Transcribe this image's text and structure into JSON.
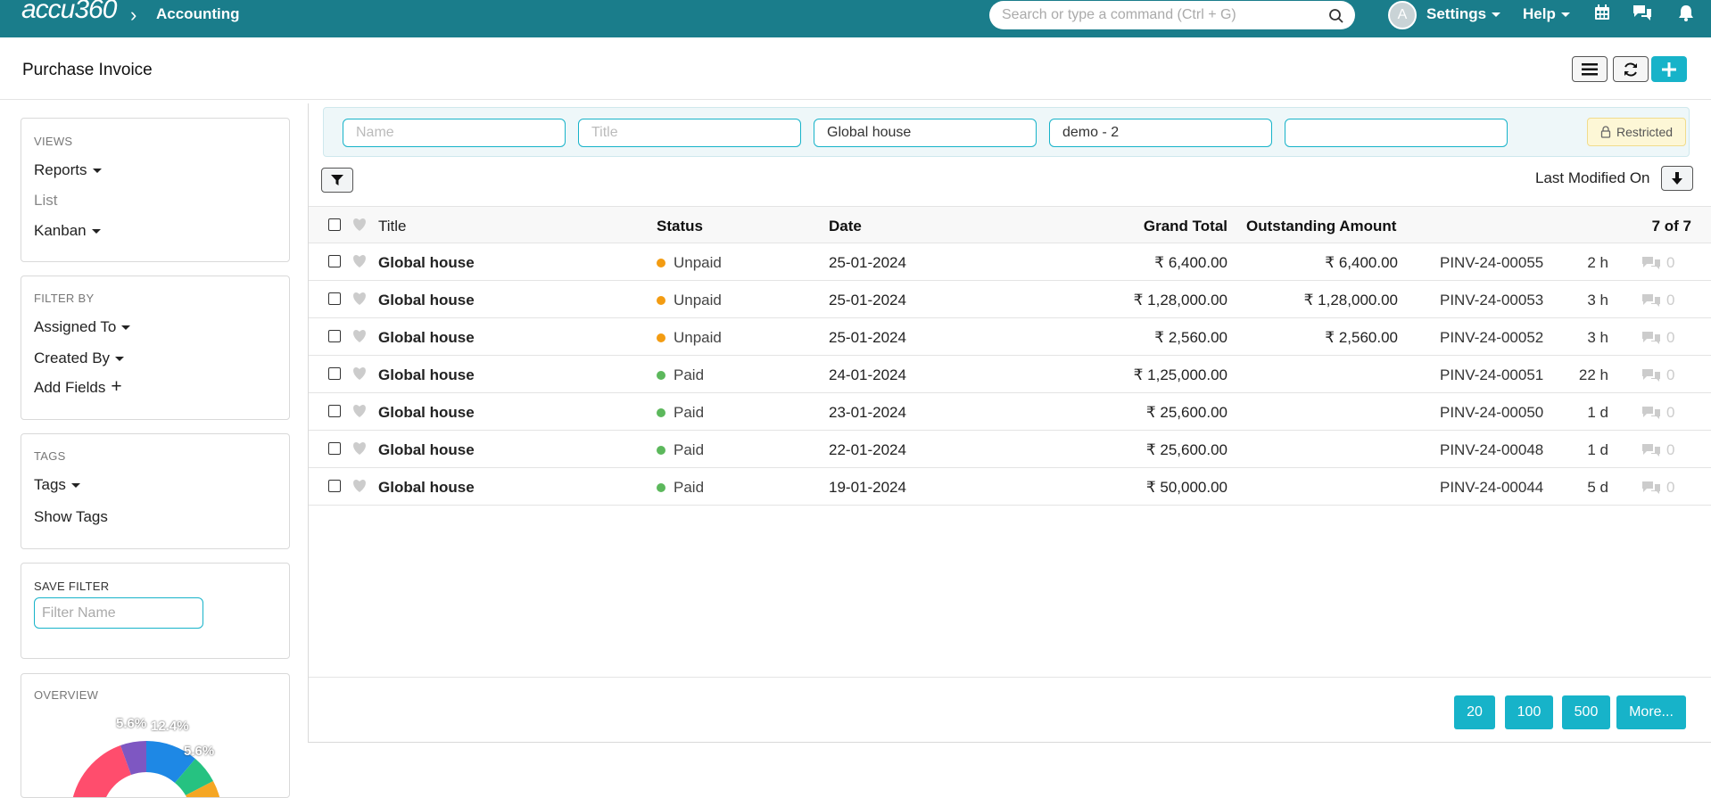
{
  "nav": {
    "logo": "accu360",
    "breadcrumb": "Accounting",
    "search_placeholder": "Search or type a command (Ctrl + G)",
    "avatar_initial": "A",
    "settings_label": "Settings",
    "help_label": "Help"
  },
  "page": {
    "title": "Purchase Invoice"
  },
  "sidebar": {
    "views_heading": "VIEWS",
    "views": [
      "Reports",
      "List",
      "Kanban"
    ],
    "filter_heading": "FILTER BY",
    "filters": [
      "Assigned To",
      "Created By",
      "Add Fields"
    ],
    "tags_heading": "TAGS",
    "tags": [
      "Tags",
      "Show Tags"
    ],
    "save_filter_heading": "SAVE FILTER",
    "filter_name_placeholder": "Filter Name",
    "overview_heading": "OVERVIEW",
    "overview_labels": [
      "5.6%",
      "12.4%",
      "5.6%"
    ]
  },
  "filters": {
    "name_placeholder": "Name",
    "title_placeholder": "Title",
    "supplier_value": "Global house",
    "company_value": "demo - 2",
    "extra_value": "",
    "restricted_label": "Restricted",
    "sort_label": "Last Modified On"
  },
  "table": {
    "headers": {
      "title": "Title",
      "status": "Status",
      "date": "Date",
      "grand_total": "Grand Total",
      "outstanding": "Outstanding Amount",
      "count": "7 of 7"
    },
    "rows": [
      {
        "title": "Global house",
        "status": "Unpaid",
        "status_color": "#f39c12",
        "date": "25-01-2024",
        "grand_total": "₹ 6,400.00",
        "outstanding": "₹ 6,400.00",
        "name": "PINV-24-00055",
        "age": "2 h",
        "comments": "0"
      },
      {
        "title": "Global house",
        "status": "Unpaid",
        "status_color": "#f39c12",
        "date": "25-01-2024",
        "grand_total": "₹ 1,28,000.00",
        "outstanding": "₹ 1,28,000.00",
        "name": "PINV-24-00053",
        "age": "3 h",
        "comments": "0"
      },
      {
        "title": "Global house",
        "status": "Unpaid",
        "status_color": "#f39c12",
        "date": "25-01-2024",
        "grand_total": "₹ 2,560.00",
        "outstanding": "₹ 2,560.00",
        "name": "PINV-24-00052",
        "age": "3 h",
        "comments": "0"
      },
      {
        "title": "Global house",
        "status": "Paid",
        "status_color": "#5cb85c",
        "date": "24-01-2024",
        "grand_total": "₹ 1,25,000.00",
        "outstanding": "",
        "name": "PINV-24-00051",
        "age": "22 h",
        "comments": "0"
      },
      {
        "title": "Global house",
        "status": "Paid",
        "status_color": "#5cb85c",
        "date": "23-01-2024",
        "grand_total": "₹ 25,600.00",
        "outstanding": "",
        "name": "PINV-24-00050",
        "age": "1 d",
        "comments": "0"
      },
      {
        "title": "Global house",
        "status": "Paid",
        "status_color": "#5cb85c",
        "date": "22-01-2024",
        "grand_total": "₹ 25,600.00",
        "outstanding": "",
        "name": "PINV-24-00048",
        "age": "1 d",
        "comments": "0"
      },
      {
        "title": "Global house",
        "status": "Paid",
        "status_color": "#5cb85c",
        "date": "19-01-2024",
        "grand_total": "₹ 50,000.00",
        "outstanding": "",
        "name": "PINV-24-00044",
        "age": "5 d",
        "comments": "0"
      }
    ]
  },
  "pager": [
    "20",
    "100",
    "500",
    "More..."
  ],
  "colors": {
    "nav_bg": "#1a7d8b",
    "primary": "#17b3c9",
    "unpaid": "#f39c12",
    "paid": "#5cb85c"
  }
}
